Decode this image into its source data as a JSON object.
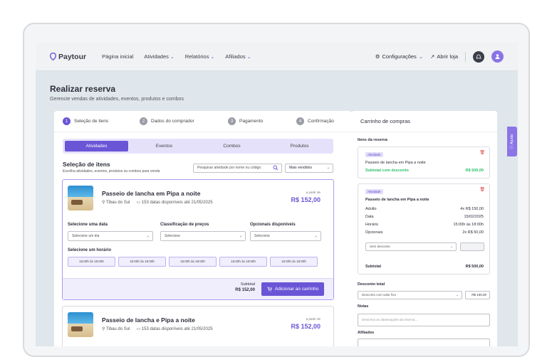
{
  "brand": {
    "name": "Paytour",
    "accent": "#6a55d6"
  },
  "nav": {
    "items": [
      {
        "label": "Página inicial",
        "dd": false
      },
      {
        "label": "Atividades",
        "dd": true
      },
      {
        "label": "Relatórios",
        "dd": true
      },
      {
        "label": "Afiliados",
        "dd": true
      }
    ],
    "settings": "Configurações",
    "open_store": "Abrir loja"
  },
  "page": {
    "title": "Realizar reserva",
    "subtitle": "Gerencie vendas de atividades, eventos, produtos e combos"
  },
  "steps": [
    {
      "n": "1",
      "label": "Seleção de itens",
      "active": true
    },
    {
      "n": "2",
      "label": "Dados do comprador",
      "active": false
    },
    {
      "n": "3",
      "label": "Pagamento",
      "active": false
    },
    {
      "n": "4",
      "label": "Confirmação",
      "active": false
    }
  ],
  "tabs": [
    {
      "label": "Atividades",
      "active": true
    },
    {
      "label": "Eventos",
      "active": false
    },
    {
      "label": "Combos",
      "active": false
    },
    {
      "label": "Produtos",
      "active": false
    }
  ],
  "selection": {
    "title": "Seleção de itens",
    "subtitle": "Escolha atividades, eventos, produtos ou combos para venda",
    "search_placeholder": "Pesquisar atividade por nome ou código",
    "sort": "Mais vendidos"
  },
  "cards": [
    {
      "title": "Passeio de lancha em Pipa a noite",
      "location": "Tibau do Sul",
      "dates": "153 datas disponíveis até 21/05/2025",
      "from": "a partir de",
      "price": "R$ 152,00"
    },
    {
      "title": "Passeio de lancha e Pipa a noite",
      "location": "Tibau do Sul",
      "dates": "153 datas disponíveis até 21/05/2025",
      "from": "a partir de",
      "price": "R$ 152,00"
    }
  ],
  "options": {
    "date_label": "Selecione uma data",
    "date_value": "Selecione um dia",
    "price_label": "Classificação de preços",
    "price_value": "Selecione",
    "extra_label": "Opcionais disponíveis",
    "extra_value": "Selecione",
    "hour_label": "Selecione um horário",
    "hours": [
      "15:00h às 18:00h",
      "15:00h às 18:00h",
      "15:00h às 18:00h",
      "15:00h às 18:00h",
      "15:00h às 18:00h"
    ]
  },
  "card_footer": {
    "subtotal_label": "Subtotal",
    "subtotal_value": "R$ 152,00",
    "add_button": "Adicionar ao carrinho"
  },
  "cart": {
    "title": "Carrinho de compras",
    "items_label": "Itens da reserva",
    "item1": {
      "badge": "Atividade",
      "title": "Passeio de lancha em Pipa a noite",
      "sub_label": "Subtotal com desconto",
      "sub_value": "R$ 500,00"
    },
    "item2": {
      "badge": "Atividade",
      "title": "Passeio de lancha em Pipa a noite",
      "rows": [
        {
          "k": "Adulto",
          "v": "4x R$ 150,00"
        },
        {
          "k": "Data",
          "v": "15/02/2025"
        },
        {
          "k": "Horário",
          "v": "15:00h às 18:00h"
        },
        {
          "k": "Opcionais",
          "v": "2x R$ 50,00"
        }
      ],
      "discount_select": "Sem desconto",
      "subtotal_label": "Subtotal",
      "subtotal_value": "R$ 500,00"
    },
    "total_discount_label": "Desconto total",
    "total_discount_select": "Desconto com valor fixo",
    "total_discount_value": "R$ 100,00",
    "notes_label": "Notas",
    "notes_placeholder": "Descreva as observações da reserva...",
    "affiliates_label": "Afiliados"
  },
  "help": "Ajuda"
}
